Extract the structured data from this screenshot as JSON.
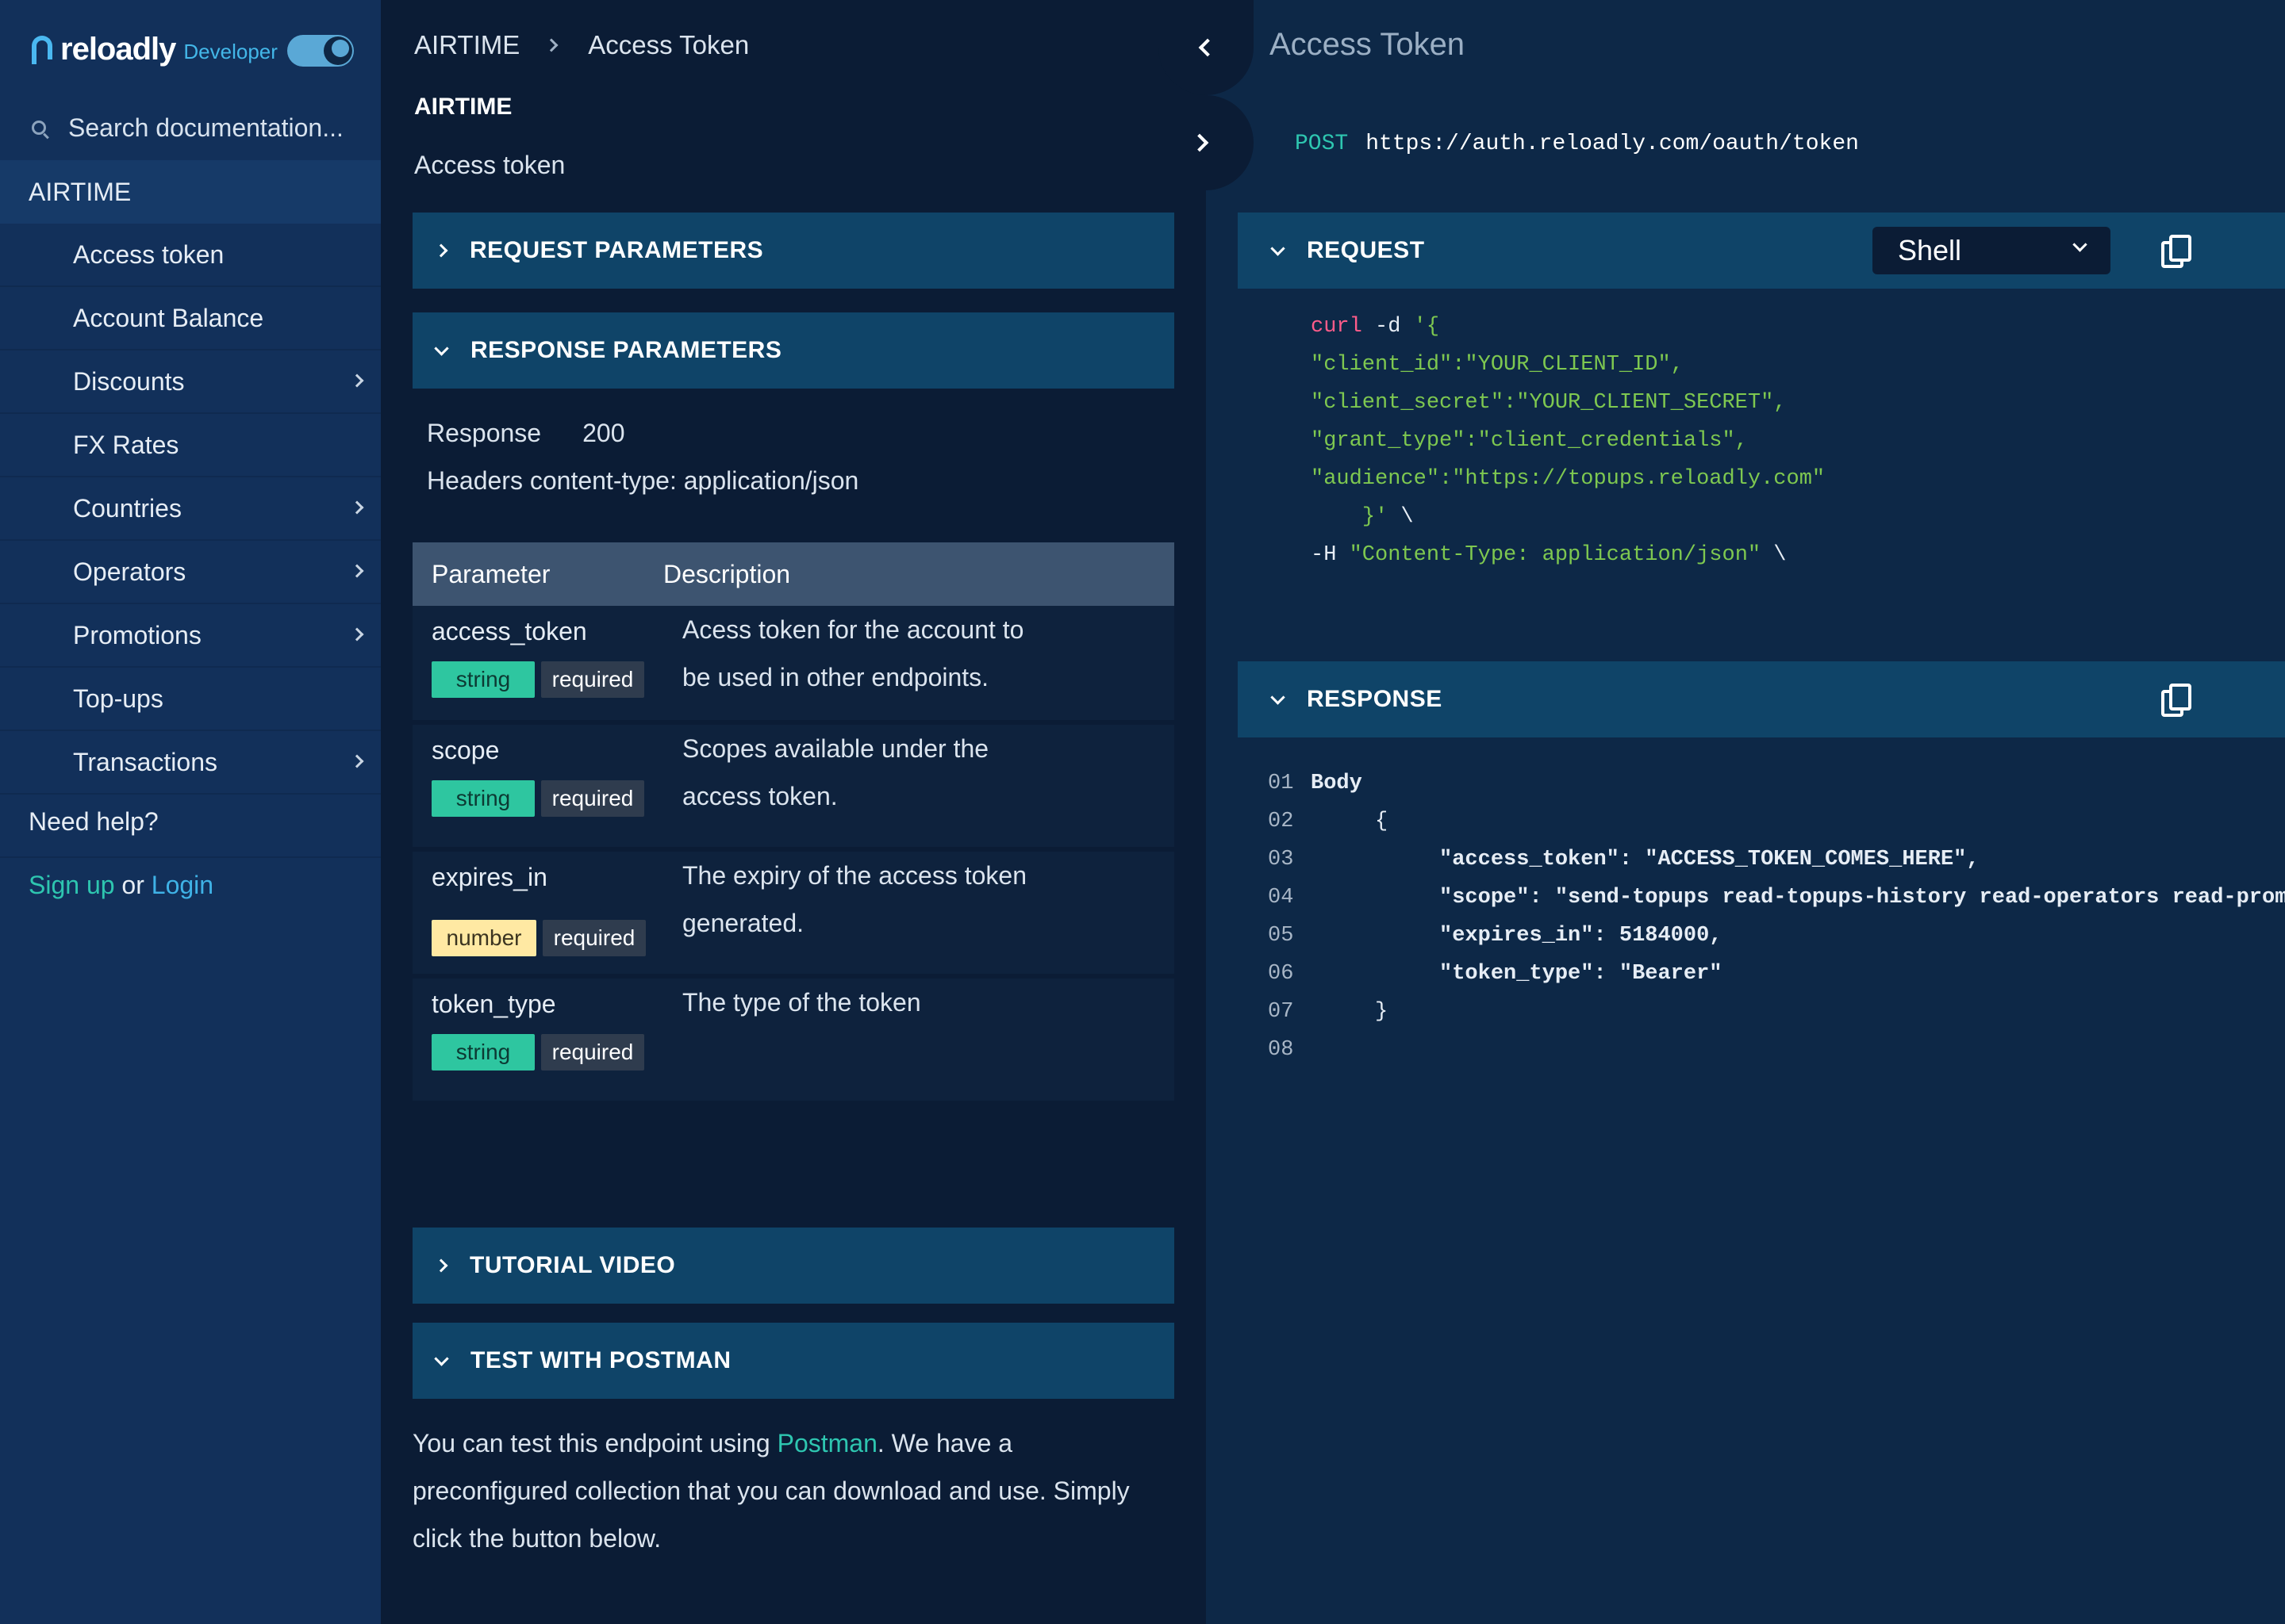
{
  "brand": {
    "name": "reloadly",
    "sub": "Developer"
  },
  "search": {
    "placeholder": "Search documentation..."
  },
  "sidebar": {
    "section": "AIRTIME",
    "items": [
      {
        "label": "Access token",
        "has_children": false
      },
      {
        "label": "Account Balance",
        "has_children": false
      },
      {
        "label": "Discounts",
        "has_children": true
      },
      {
        "label": "FX Rates",
        "has_children": false
      },
      {
        "label": "Countries",
        "has_children": true
      },
      {
        "label": "Operators",
        "has_children": true
      },
      {
        "label": "Promotions",
        "has_children": true
      },
      {
        "label": "Top-ups",
        "has_children": false
      },
      {
        "label": "Transactions",
        "has_children": true
      }
    ],
    "need_help": "Need help?",
    "signup": "Sign up",
    "or": "or",
    "login": "Login"
  },
  "breadcrumb": {
    "root": "AIRTIME",
    "current": "Access Token"
  },
  "main": {
    "section_title": "AIRTIME",
    "section_sub": "Access token",
    "request_params": "REQUEST PARAMETERS",
    "response_params": "RESPONSE PARAMETERS",
    "response_label": "Response",
    "response_code": "200",
    "headers_line": "Headers content-type: application/json",
    "table": {
      "col_param": "Parameter",
      "col_desc": "Description",
      "rows": [
        {
          "name": "access_token",
          "type": "string",
          "required": "required",
          "desc_1": "Acess token for the account to",
          "desc_2": "be used in other endpoints."
        },
        {
          "name": "scope",
          "type": "string",
          "required": "required",
          "desc_1": "Scopes available under the",
          "desc_2": "access token."
        },
        {
          "name": "expires_in",
          "type": "number",
          "required": "required",
          "desc_1": "The expiry of the access token",
          "desc_2": "generated."
        },
        {
          "name": "token_type",
          "type": "string",
          "required": "required",
          "desc_1": "The type of the token",
          "desc_2": ""
        }
      ]
    },
    "tutorial_video": "TUTORIAL VIDEO",
    "test_postman": "TEST WITH POSTMAN",
    "postman_text_1": "You can test this endpoint using ",
    "postman_link": "Postman",
    "postman_text_2": ". We have a preconfigured collection that you can download and use. Simply click the button below."
  },
  "code_panel": {
    "title": "Access Token",
    "method": "POST",
    "url": "https://auth.reloadly.com/oauth/token",
    "request_label": "REQUEST",
    "language": "Shell",
    "request_code": [
      {
        "kw": "curl",
        "plain": " -d ",
        "str": "'{"
      },
      {
        "kw": "",
        "plain": "",
        "str": "\"client_id\":\"YOUR_CLIENT_ID\","
      },
      {
        "kw": "",
        "plain": "",
        "str": "\"client_secret\":\"YOUR_CLIENT_SECRET\","
      },
      {
        "kw": "",
        "plain": "",
        "str": "\"grant_type\":\"client_credentials\","
      },
      {
        "kw": "",
        "plain": "",
        "str": "\"audience\":\"https://topups.reloadly.com\""
      },
      {
        "kw": "",
        "plain": "    ",
        "str": "}'",
        "tail": " \\"
      },
      {
        "kw": "",
        "plain": "-H ",
        "str": "\"Content-Type: application/json\"",
        "tail": " \\"
      }
    ],
    "response_label": "RESPONSE",
    "response_lines": [
      {
        "n": "01",
        "text": "Body",
        "bold": true
      },
      {
        "n": "02",
        "text": "     {"
      },
      {
        "n": "03",
        "key": "\"access_token\"",
        "val": ": \"ACCESS_TOKEN_COMES_HERE\","
      },
      {
        "n": "04",
        "key": "\"scope\"",
        "val": ": \"send-topups read-topups-history read-operators read-promotions read-topups-commissions read-prepaid-balance read-prepaid-commissions\","
      },
      {
        "n": "05",
        "key": "\"expires_in\"",
        "val": ": 5184000,"
      },
      {
        "n": "06",
        "key": "\"token_type\"",
        "val": ": \"Bearer\""
      },
      {
        "n": "07",
        "text": "     }"
      },
      {
        "n": "08",
        "text": ""
      }
    ]
  },
  "colors": {
    "accent": "#2ec6b0",
    "panel": "#0f4468",
    "sidebar": "#12305a",
    "string_badge": "#2ec6a0",
    "number_badge": "#ffe9a3"
  }
}
